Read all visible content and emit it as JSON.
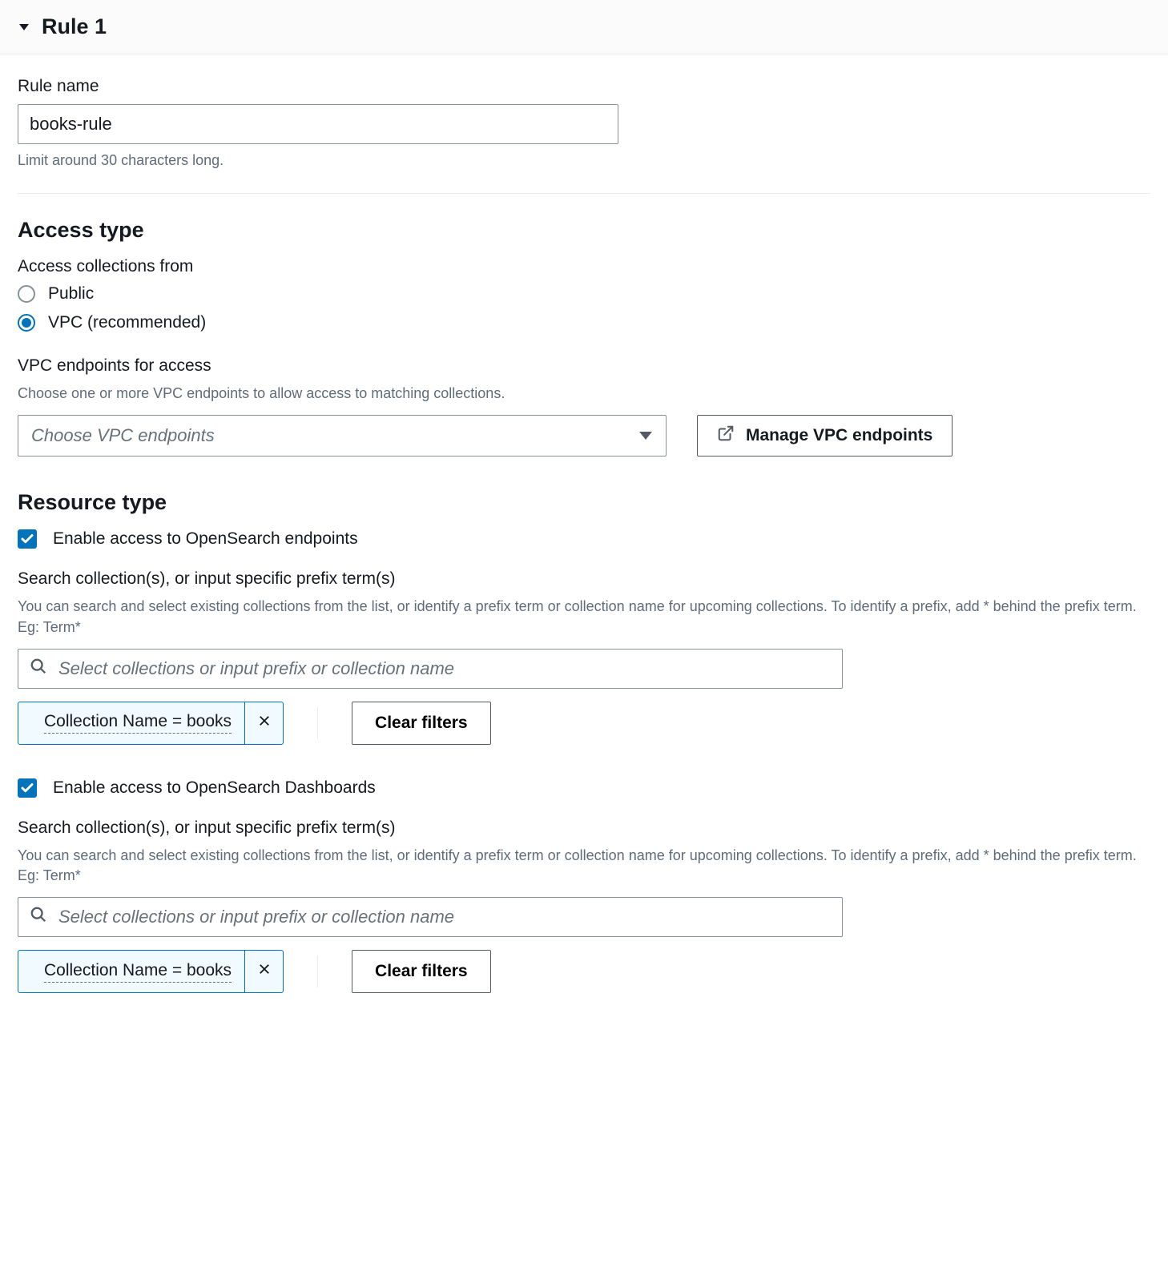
{
  "header": {
    "title": "Rule 1"
  },
  "ruleName": {
    "label": "Rule name",
    "value": "books-rule",
    "helper": "Limit around 30 characters long."
  },
  "accessType": {
    "title": "Access type",
    "subLabel": "Access collections from",
    "options": {
      "public": "Public",
      "vpc": "VPC (recommended)"
    },
    "vpcEndpoints": {
      "label": "VPC endpoints for access",
      "description": "Choose one or more VPC endpoints to allow access to matching collections.",
      "placeholder": "Choose VPC endpoints",
      "manageButton": "Manage VPC endpoints"
    }
  },
  "resourceType": {
    "title": "Resource type",
    "endpoints": {
      "checkboxLabel": "Enable access to OpenSearch endpoints",
      "searchLabel": "Search collection(s), or input specific prefix term(s)",
      "searchDescription": "You can search and select existing collections from the list, or identify a prefix term or collection name for upcoming collections. To identify a prefix, add * behind the prefix term. Eg: Term*",
      "searchPlaceholder": "Select collections or input prefix or collection name",
      "token": "Collection Name = books",
      "clearFilters": "Clear filters"
    },
    "dashboards": {
      "checkboxLabel": "Enable access to OpenSearch Dashboards",
      "searchLabel": "Search collection(s), or input specific prefix term(s)",
      "searchDescription": "You can search and select existing collections from the list, or identify a prefix term or collection name for upcoming collections. To identify a prefix, add * behind the prefix term. Eg: Term*",
      "searchPlaceholder": "Select collections or input prefix or collection name",
      "token": "Collection Name = books",
      "clearFilters": "Clear filters"
    }
  }
}
